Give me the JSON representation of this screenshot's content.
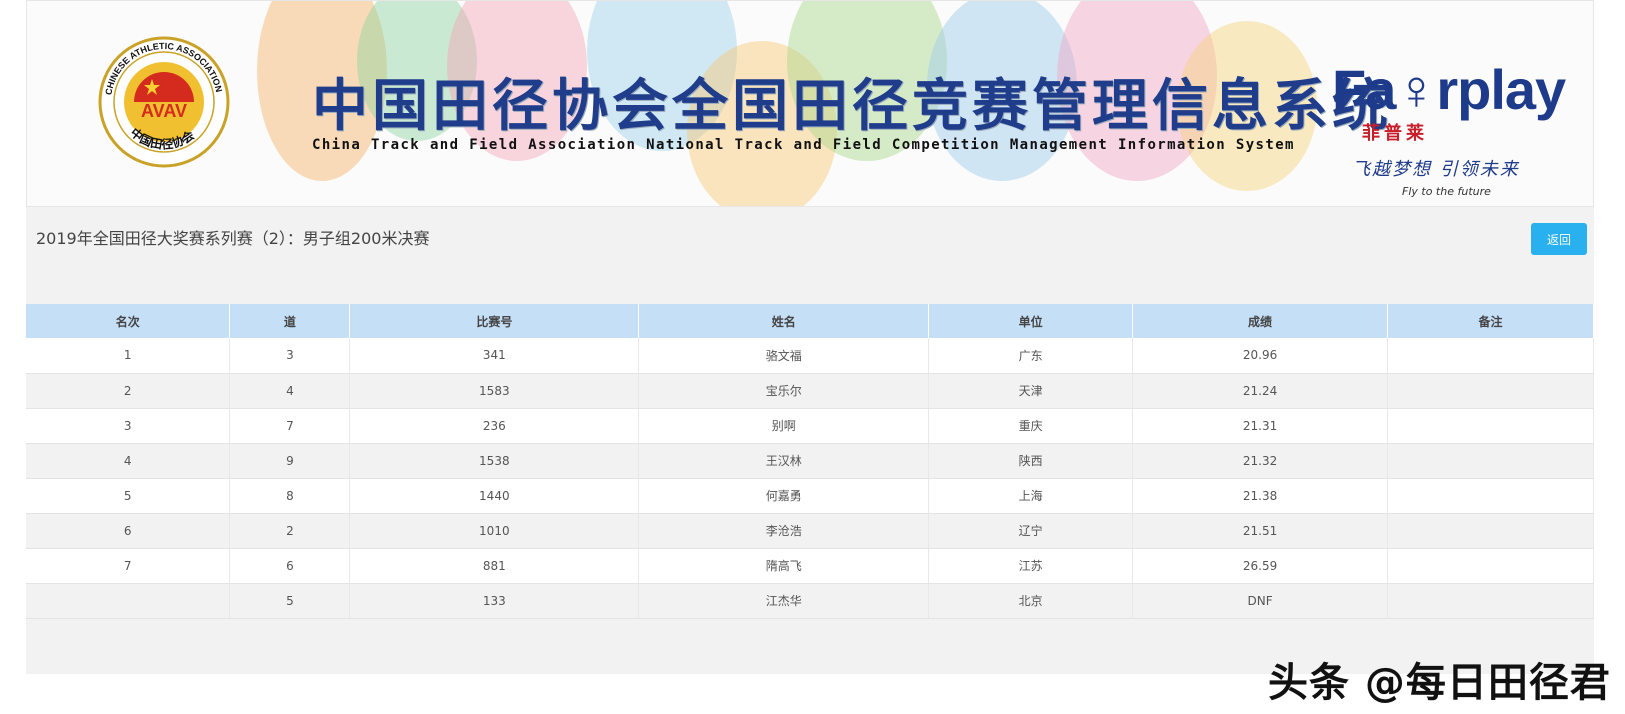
{
  "banner": {
    "title": "中国田径协会全国田径竞赛管理信息系统",
    "subtitle": "China Track and Field Association National Track and Field Competition Management Information System",
    "caa_logo": {
      "text_top": "CHINESE ATHLETIC ASSOCIATION",
      "text_bottom": "中国田径协会",
      "emblem": "AVAV"
    },
    "fairplay_logo": {
      "word": "Fa♀rplay",
      "cn": "菲普莱",
      "slogan": "飞越梦想 引领未来",
      "en": "Fly to the future"
    }
  },
  "event": {
    "title": "2019年全国田径大奖赛系列赛（2）：男子组200米决赛",
    "back_label": "返回"
  },
  "table": {
    "headers": [
      "名次",
      "道",
      "比赛号",
      "姓名",
      "单位",
      "成绩",
      "备注"
    ],
    "rows": [
      [
        "1",
        "3",
        "341",
        "骆文福",
        "广东",
        "20.96",
        ""
      ],
      [
        "2",
        "4",
        "1583",
        "宝乐尔",
        "天津",
        "21.24",
        ""
      ],
      [
        "3",
        "7",
        "236",
        "别啊",
        "重庆",
        "21.31",
        ""
      ],
      [
        "4",
        "9",
        "1538",
        "王汉林",
        "陕西",
        "21.32",
        ""
      ],
      [
        "5",
        "8",
        "1440",
        "何嘉勇",
        "上海",
        "21.38",
        ""
      ],
      [
        "6",
        "2",
        "1010",
        "李沧浩",
        "辽宁",
        "21.51",
        ""
      ],
      [
        "7",
        "6",
        "881",
        "隋高飞",
        "江苏",
        "26.59",
        ""
      ],
      [
        "",
        "5",
        "133",
        "江杰华",
        "北京",
        "DNF",
        ""
      ]
    ]
  },
  "watermark": "头条 @每日田径君",
  "colors": {
    "header_bg": "#c5dff7",
    "button_bg": "#29b0ee",
    "title_blue": "#1f3d8a",
    "brand_red": "#c81e2a"
  }
}
